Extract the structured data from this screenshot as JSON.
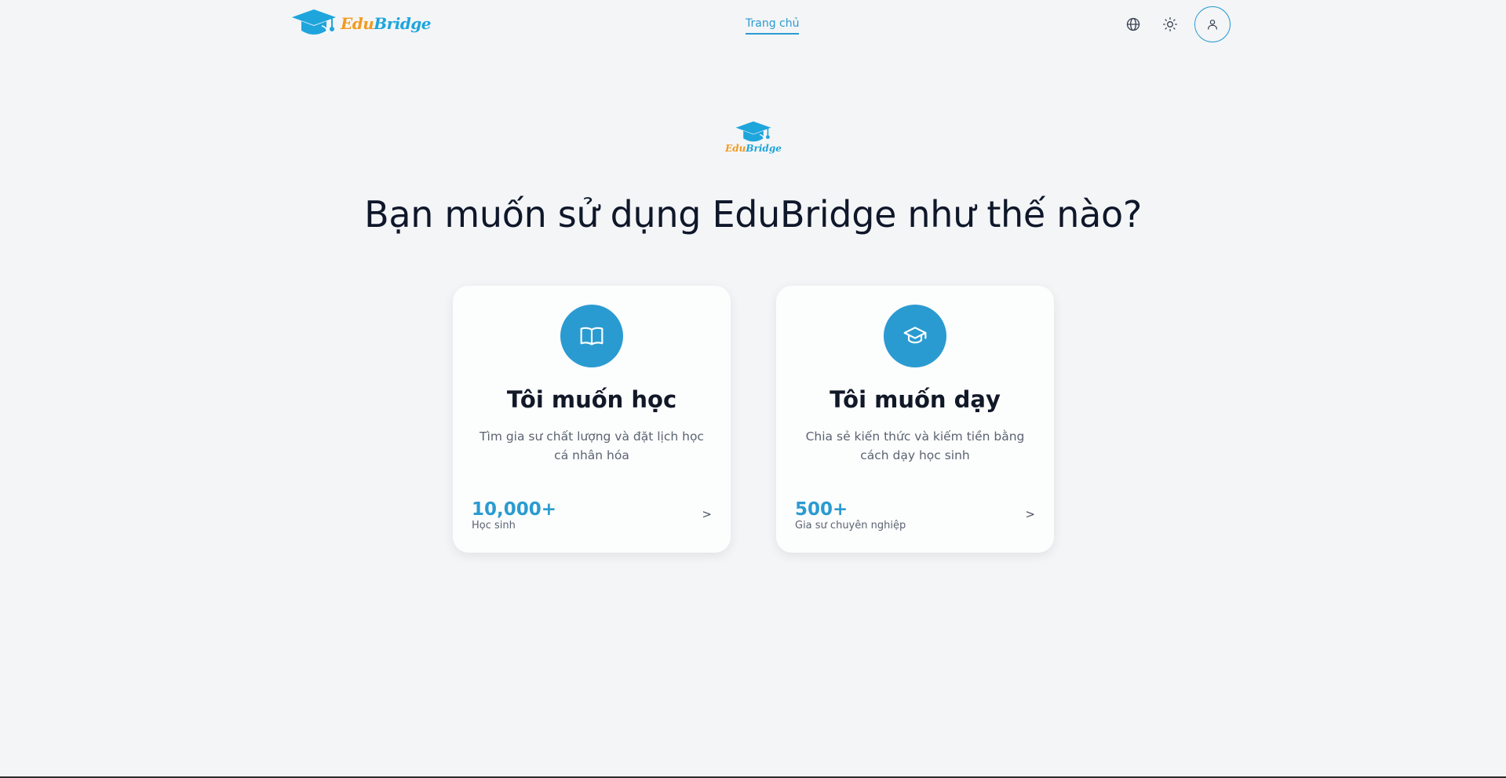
{
  "brand": {
    "part1": "Edu",
    "part2": "Bridge"
  },
  "nav": {
    "home_label": "Trang chủ"
  },
  "header_icons": {
    "language": "globe-icon",
    "theme": "sun-icon",
    "account": "user-icon"
  },
  "headline": "Bạn muốn sử dụng EduBridge như thế nào?",
  "cards": [
    {
      "icon": "book-open-icon",
      "title": "Tôi muốn học",
      "description": "Tìm gia sư chất lượng và đặt lịch học cá nhân hóa",
      "stat_value": "10,000+",
      "stat_label": "Học sinh",
      "chevron": ">"
    },
    {
      "icon": "graduation-cap-icon",
      "title": "Tôi muốn dạy",
      "description": "Chia sẻ kiến thức và kiếm tiền bằng cách dạy học sinh",
      "stat_value": "500+",
      "stat_label": "Gia sư chuyên nghiệp",
      "chevron": ">"
    }
  ],
  "colors": {
    "accent": "#2a9bd1",
    "brand_orange": "#f29a1f",
    "brand_blue": "#1ea5dc",
    "background": "#f4f5f7"
  }
}
